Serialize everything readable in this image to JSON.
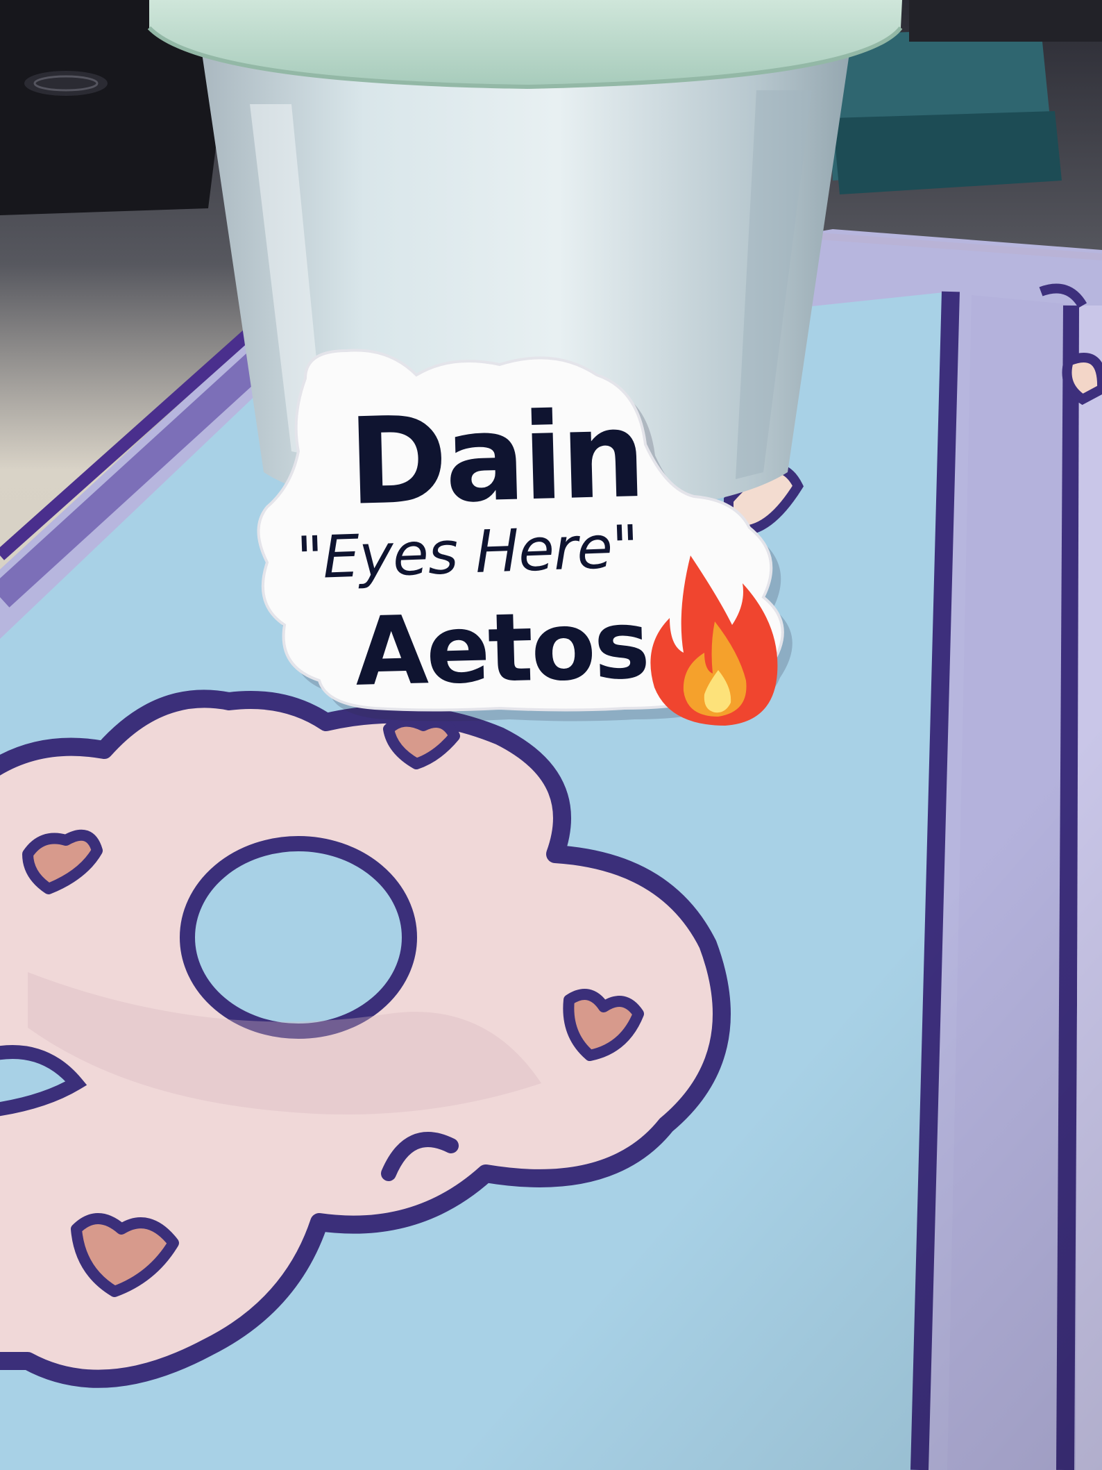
{
  "sticker": {
    "line1": "Dain",
    "line2": "\"Eyes Here\"",
    "line3": "Aetos",
    "emoji": "fire-icon"
  },
  "colors": {
    "sticker_bg": "#fbfbfb",
    "sticker_text": "#0f1430",
    "mousepad_blue": "#a9d3e6",
    "mousepad_lavender": "#b4b5dc",
    "mousepad_outline": "#3b2f7a",
    "cloud_fill": "#f0d7d8",
    "heart_fill": "#d99b8c",
    "cup_color": "#c5dbe2",
    "lid_color": "#b6d8c8"
  }
}
